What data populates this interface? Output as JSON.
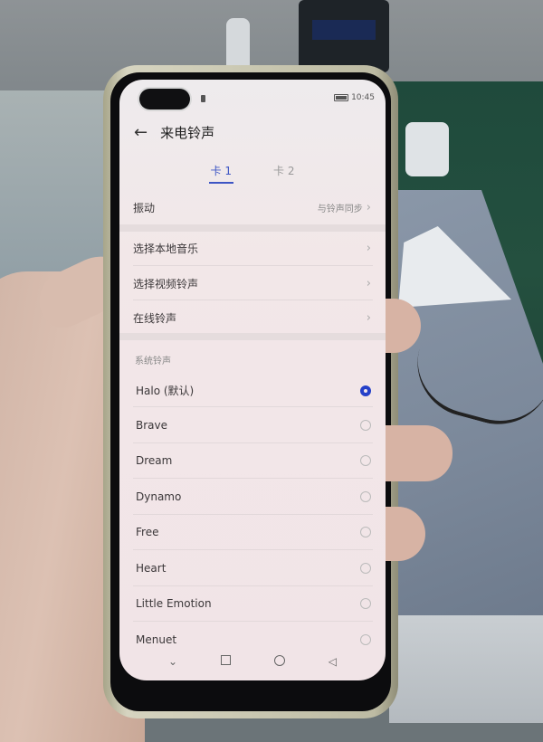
{
  "status_bar": {
    "time": "10:45"
  },
  "header": {
    "back_icon": "←",
    "title": "来电铃声"
  },
  "tabs": [
    {
      "label": "卡 1",
      "active": true
    },
    {
      "label": "卡 2",
      "active": false
    }
  ],
  "vibration": {
    "label": "振动",
    "value": "与铃声同步",
    "chevron": "›"
  },
  "options": [
    {
      "label": "选择本地音乐",
      "chevron": "›"
    },
    {
      "label": "选择视频铃声",
      "chevron": "›"
    },
    {
      "label": "在线铃声",
      "chevron": "›"
    }
  ],
  "system_section": {
    "label": "系统铃声"
  },
  "ringtones": [
    {
      "name": "Halo (默认)",
      "selected": true
    },
    {
      "name": "Brave",
      "selected": false
    },
    {
      "name": "Dream",
      "selected": false
    },
    {
      "name": "Dynamo",
      "selected": false
    },
    {
      "name": "Free",
      "selected": false
    },
    {
      "name": "Heart",
      "selected": false
    },
    {
      "name": "Little Emotion",
      "selected": false
    },
    {
      "name": "Menuet",
      "selected": false
    }
  ],
  "navbar": {
    "down": "⌄",
    "home_icon": "circle",
    "recent_icon": "square",
    "back": "◁"
  },
  "colors": {
    "accent": "#2540c9"
  }
}
